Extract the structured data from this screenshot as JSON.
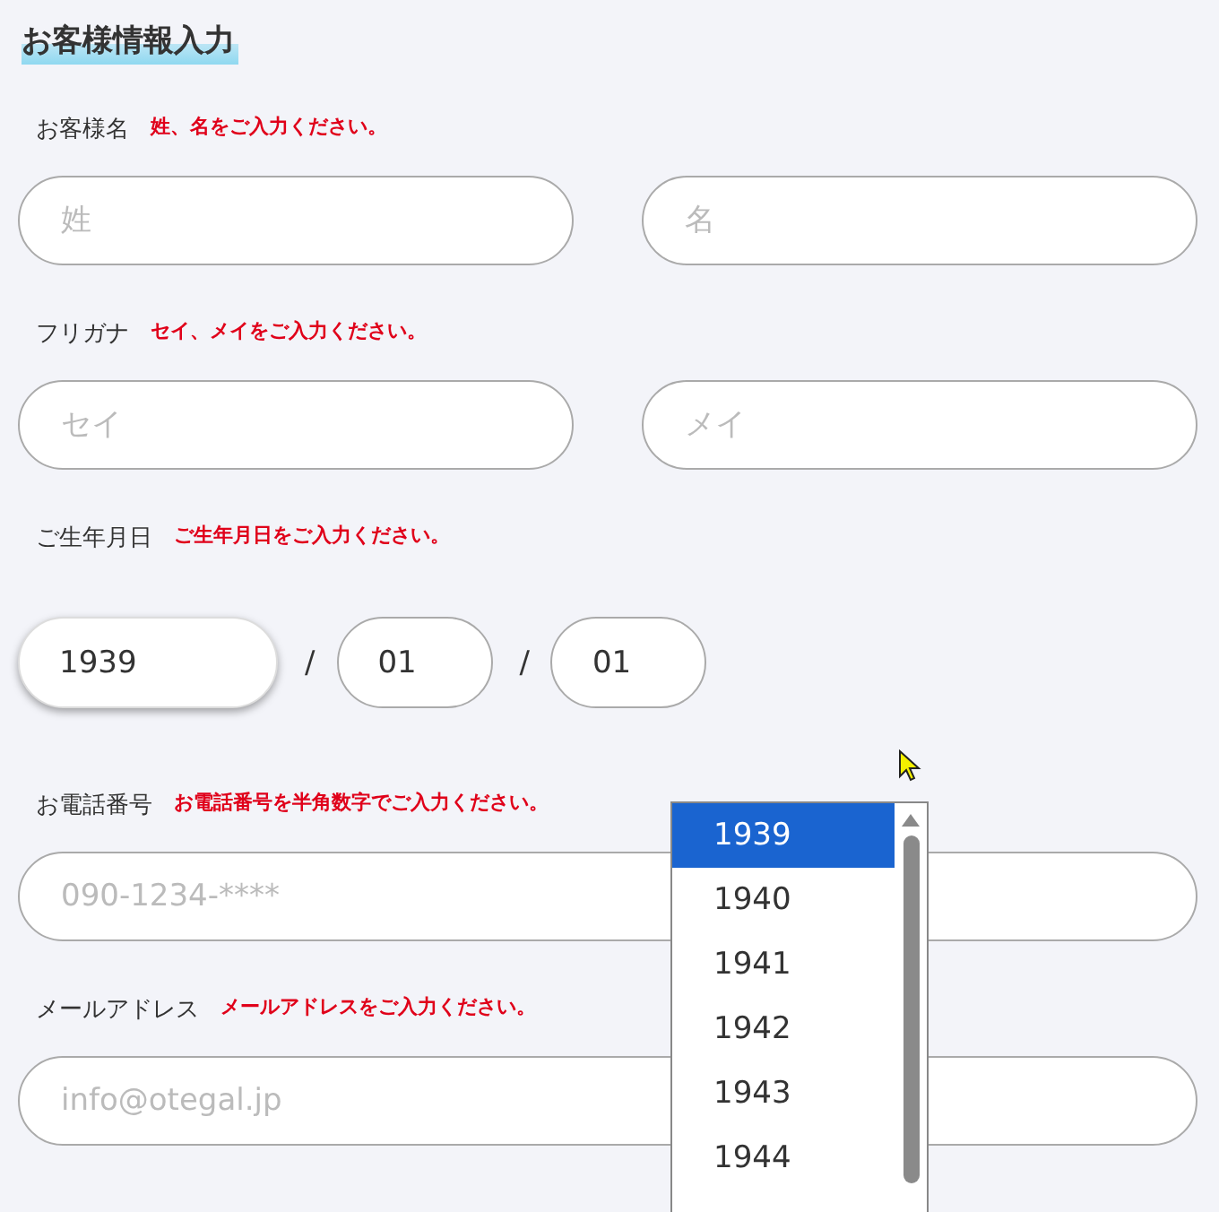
{
  "title": "お客様情報入力",
  "sections": [
    {
      "kind": "pair",
      "label": "お客様名",
      "hint": "姓、名をご入力ください。",
      "fields": [
        {
          "placeholder": "姓"
        },
        {
          "placeholder": "名"
        }
      ]
    },
    {
      "kind": "pair",
      "label": "フリガナ",
      "hint": "セイ、メイをご入力ください。",
      "fields": [
        {
          "placeholder": "セイ"
        },
        {
          "placeholder": "メイ"
        }
      ]
    },
    {
      "kind": "date",
      "label": "ご生年月日",
      "hint": "ご生年月日をご入力ください。",
      "parts": [
        {
          "kind": "select",
          "value": "1939",
          "focused": true
        },
        {
          "kind": "separator",
          "text": "/"
        },
        {
          "kind": "select",
          "value": "01",
          "focused": false
        },
        {
          "kind": "separator",
          "text": "/"
        },
        {
          "kind": "select",
          "value": "01",
          "focused": false
        }
      ]
    },
    {
      "kind": "single",
      "label": "お電話番号",
      "hint": "お電話番号を半角数字でご入力ください。",
      "fields": [
        {
          "placeholder": "090-1234-****"
        }
      ]
    },
    {
      "kind": "single",
      "label": "メールアドレス",
      "hint": "メールアドレスをご入力ください。",
      "fields": [
        {
          "placeholder": "info@otegal.jp"
        }
      ]
    }
  ],
  "dropdown": {
    "options": [
      {
        "label": "1939",
        "selected": true
      },
      {
        "label": "1940",
        "selected": false
      },
      {
        "label": "1941",
        "selected": false
      },
      {
        "label": "1942",
        "selected": false
      },
      {
        "label": "1943",
        "selected": false
      },
      {
        "label": "1944",
        "selected": false
      }
    ]
  }
}
